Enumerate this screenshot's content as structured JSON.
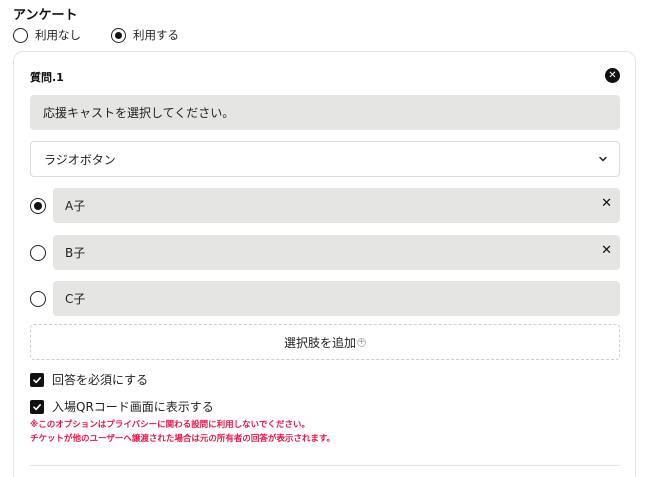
{
  "survey": {
    "title": "アンケート",
    "mode_options": [
      {
        "label": "利用なし",
        "selected": false
      },
      {
        "label": "利用する",
        "selected": true
      }
    ]
  },
  "question": {
    "label": "質問.1",
    "close_icon": "close-icon",
    "text": "応援キャストを選択してください。",
    "type_value": "ラジオボタン",
    "options": [
      {
        "label": "A子",
        "selected": true,
        "removable": true
      },
      {
        "label": "B子",
        "selected": false,
        "removable": true
      },
      {
        "label": "C子",
        "selected": false,
        "removable": false
      }
    ],
    "add_option_label": "選択肢を追加",
    "required_label": "回答を必須にする",
    "qr_label": "入場QRコード画面に表示する",
    "warning_line1": "※このオプションはプライバシーに関わる設問に利用しないでください。",
    "warning_line2": "チケットが他のユーザーへ譲渡された場合は元の所有者の回答が表示されます。",
    "remove_glyph": "✕",
    "add_glyph": "+"
  },
  "colors": {
    "warning": "#e8174b",
    "field_bg": "#e5e5e3",
    "accent": "#111111"
  }
}
